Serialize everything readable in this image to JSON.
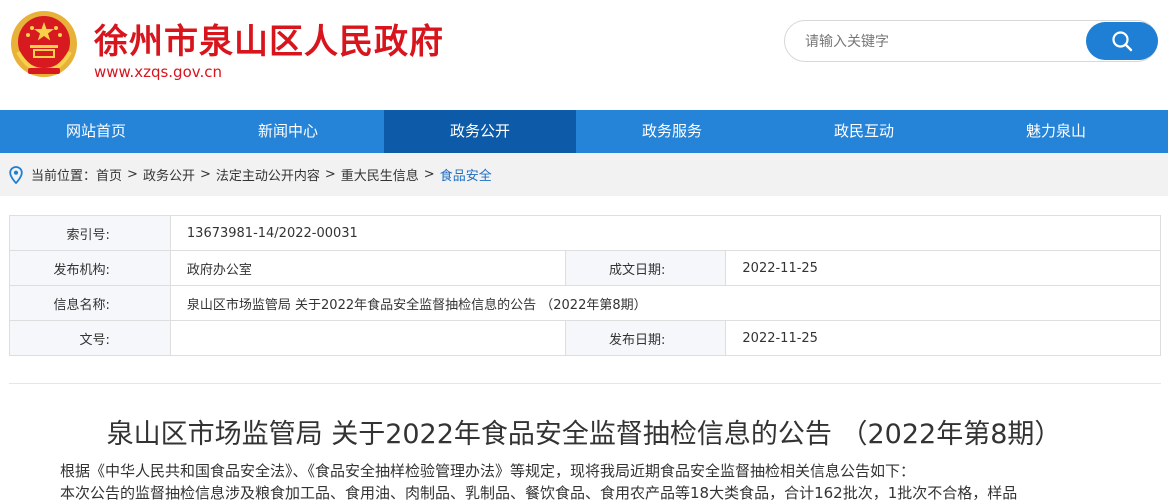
{
  "header": {
    "site_title": "徐州市泉山区人民政府",
    "site_url": "www.xzqs.gov.cn",
    "search_placeholder": "请输入关键字"
  },
  "colors": {
    "brand_red": "#d8141d",
    "nav_blue": "#2684d8",
    "nav_active": "#0c5aa8",
    "search_button": "#1e7fd4"
  },
  "nav": {
    "items": [
      {
        "label": "网站首页"
      },
      {
        "label": "新闻中心"
      },
      {
        "label": "政务公开",
        "active": true
      },
      {
        "label": "政务服务"
      },
      {
        "label": "政民互动"
      },
      {
        "label": "魅力泉山"
      }
    ]
  },
  "breadcrumb": {
    "prefix": "当前位置：",
    "items": [
      "首页",
      "政务公开",
      "法定主动公开内容",
      "重大民生信息",
      "食品安全"
    ]
  },
  "info": {
    "index_label": "索引号:",
    "index_value": "13673981-14/2022-00031",
    "org_label": "发布机构:",
    "org_value": "政府办公室",
    "created_label": "成文日期:",
    "created_value": "2022-11-25",
    "name_label": "信息名称:",
    "name_value": "泉山区市场监管局 关于2022年食品安全监督抽检信息的公告 （2022年第8期）",
    "docno_label": "文号:",
    "docno_value": "",
    "published_label": "发布日期:",
    "published_value": "2022-11-25"
  },
  "article": {
    "title": "泉山区市场监管局 关于2022年食品安全监督抽检信息的公告 （2022年第8期）",
    "para1": "根据《中华人民共和国食品安全法》、《食品安全抽样检验管理办法》等规定，现将我局近期食品安全监督抽检相关信息公告如下：",
    "para2": "本次公告的监督抽检信息涉及粮食加工品、食用油、肉制品、乳制品、餐饮食品、食用农产品等18大类食品，合计162批次，1批次不合格，样品"
  }
}
